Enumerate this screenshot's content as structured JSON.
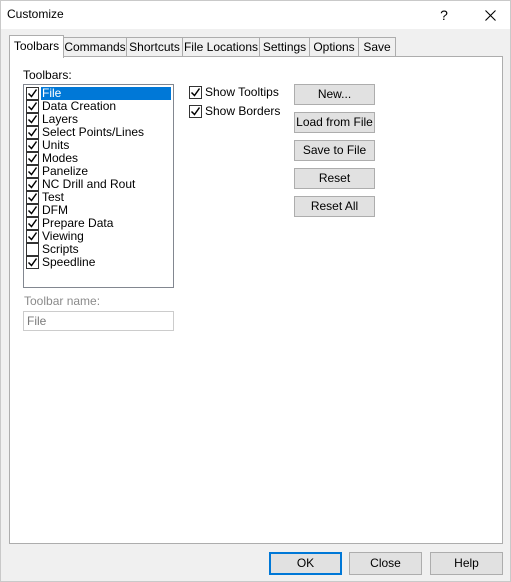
{
  "window": {
    "title": "Customize",
    "help_glyph": "?",
    "close_icon": "close-icon"
  },
  "tabs": [
    {
      "label": "Toolbars",
      "active": true
    },
    {
      "label": "Commands",
      "active": false
    },
    {
      "label": "Shortcuts",
      "active": false
    },
    {
      "label": "File Locations",
      "active": false
    },
    {
      "label": "Settings",
      "active": false
    },
    {
      "label": "Options",
      "active": false
    },
    {
      "label": "Save",
      "active": false
    }
  ],
  "toolbars_panel": {
    "list_label": "Toolbars:",
    "items": [
      {
        "label": "File",
        "checked": true,
        "selected": true
      },
      {
        "label": "Data Creation",
        "checked": true,
        "selected": false
      },
      {
        "label": "Layers",
        "checked": true,
        "selected": false
      },
      {
        "label": "Select Points/Lines",
        "checked": true,
        "selected": false
      },
      {
        "label": "Units",
        "checked": true,
        "selected": false
      },
      {
        "label": "Modes",
        "checked": true,
        "selected": false
      },
      {
        "label": "Panelize",
        "checked": true,
        "selected": false
      },
      {
        "label": "NC Drill and Rout",
        "checked": true,
        "selected": false
      },
      {
        "label": "Test",
        "checked": true,
        "selected": false
      },
      {
        "label": "DFM",
        "checked": true,
        "selected": false
      },
      {
        "label": "Prepare Data",
        "checked": true,
        "selected": false
      },
      {
        "label": "Viewing",
        "checked": true,
        "selected": false
      },
      {
        "label": "Scripts",
        "checked": false,
        "selected": false
      },
      {
        "label": "Speedline",
        "checked": true,
        "selected": false
      }
    ],
    "show_tooltips": {
      "label": "Show Tooltips",
      "checked": true
    },
    "show_borders": {
      "label": "Show Borders",
      "checked": true
    },
    "buttons": {
      "new": "New...",
      "load": "Load from File",
      "save": "Save to File",
      "reset": "Reset",
      "reset_all": "Reset All"
    },
    "toolbar_name_label": "Toolbar name:",
    "toolbar_name_value": "File"
  },
  "footer": {
    "ok": "OK",
    "close": "Close",
    "help": "Help"
  },
  "colors": {
    "selection": "#0078d7",
    "window_bg": "#f0f0f0",
    "panel_bg": "#ffffff"
  }
}
